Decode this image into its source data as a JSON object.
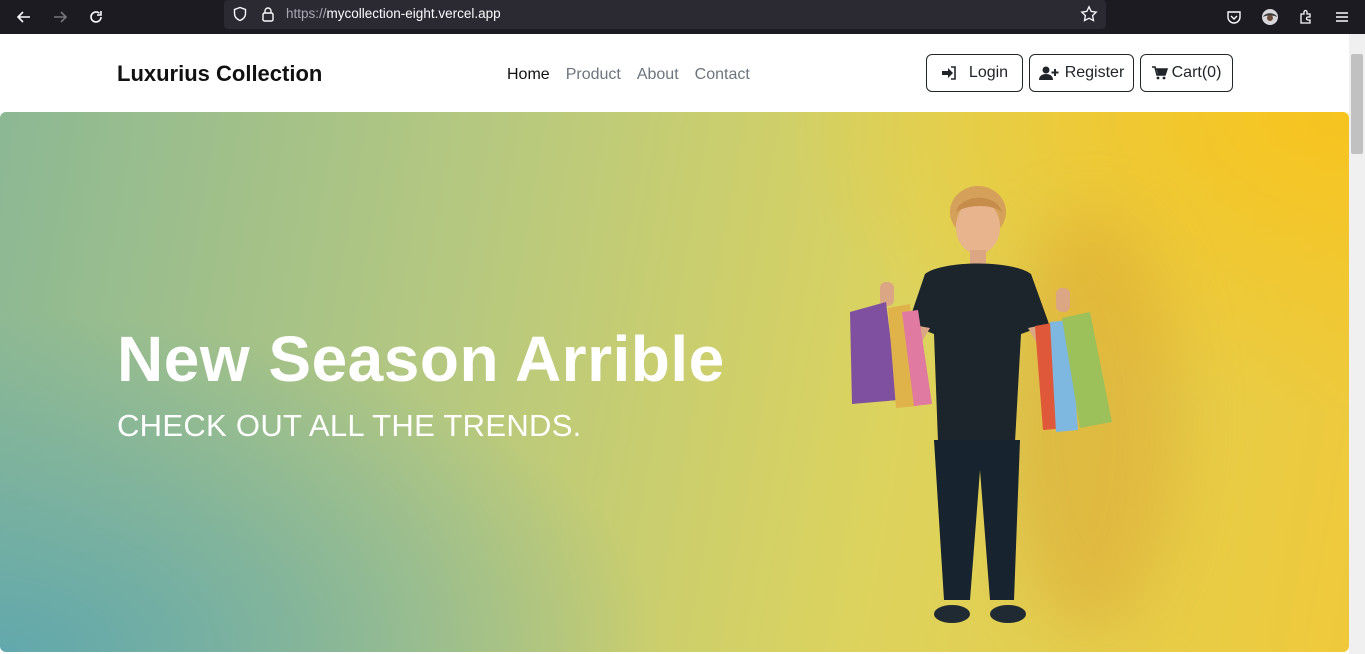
{
  "browser": {
    "url_protocol": "https://",
    "url_host": "mycollection-eight.vercel.app",
    "icons": [
      "back-arrow-icon",
      "forward-arrow-icon",
      "reload-icon",
      "shield-icon",
      "lock-icon",
      "bookmark-star-icon",
      "pocket-icon",
      "account-avatar-icon",
      "extensions-icon",
      "menu-icon"
    ]
  },
  "navbar": {
    "brand": "Luxurius Collection",
    "links": [
      {
        "label": "Home",
        "active": true
      },
      {
        "label": "Product",
        "active": false
      },
      {
        "label": "About",
        "active": false
      },
      {
        "label": "Contact",
        "active": false
      }
    ],
    "login_label": "Login",
    "register_label": "Register",
    "cart_label": "Cart(0)"
  },
  "hero": {
    "title": "New Season Arrible",
    "subtitle": "CHECK OUT ALL THE TRENDS."
  },
  "colors": {
    "chrome_bg": "#1c1b22",
    "hero_yellow": "#f7c41f",
    "hero_teal": "#62a8ad"
  }
}
